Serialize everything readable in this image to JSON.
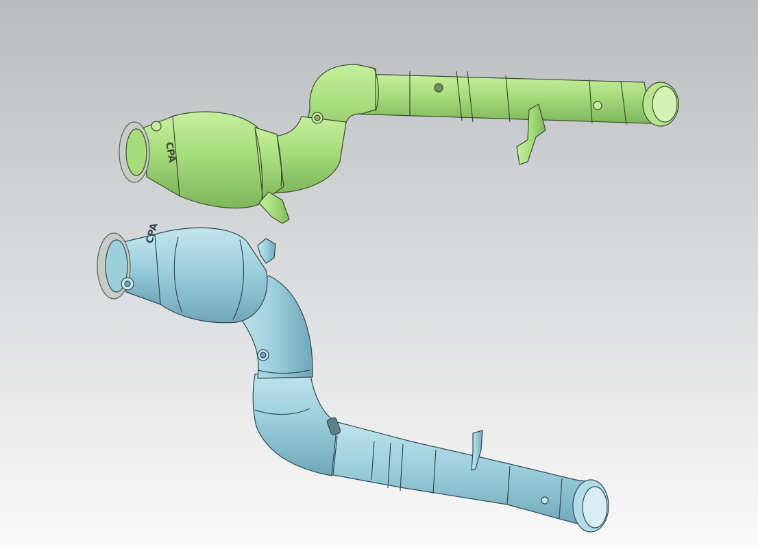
{
  "viewport": {
    "background_top": "#b9bcbf",
    "background_bottom": "#fafafa"
  },
  "parts": {
    "green_downpipe": {
      "logo_text": "CPA",
      "fill": "#a7dc7b",
      "fill_light": "#c6ee9e",
      "fill_dark": "#7db65a",
      "edge": "#3c4a2f",
      "flange_fill": "#c8ccc6",
      "flange_edge": "#5b5f59"
    },
    "blue_downpipe": {
      "logo_text": "CPA",
      "fill": "#9ccfdc",
      "fill_light": "#c3e5ee",
      "fill_dark": "#6fa7b8",
      "edge": "#2f4752",
      "flange_fill": "#c8ccc6",
      "flange_edge": "#5b5f59"
    }
  }
}
